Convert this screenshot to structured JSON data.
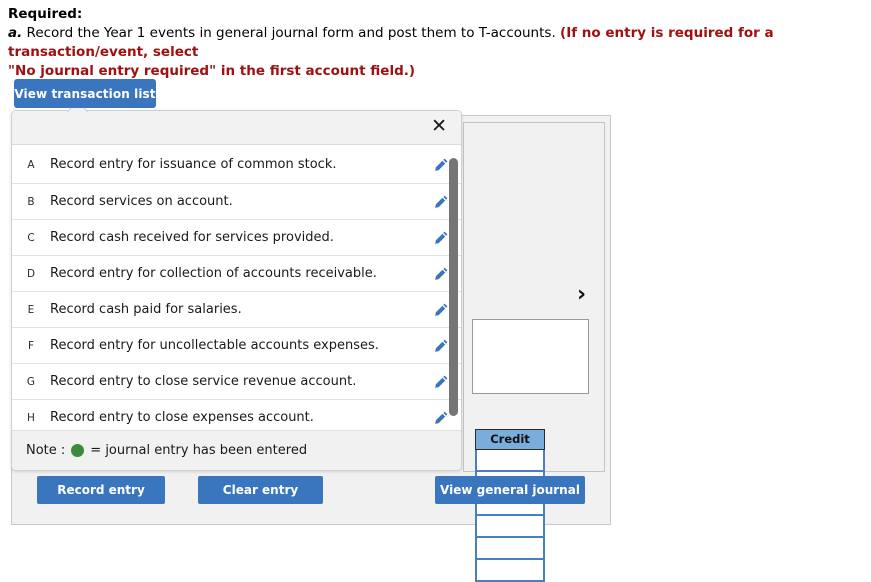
{
  "requirement": {
    "title": "Required:",
    "letter": "a.",
    "body": " Record the Year 1 events in general journal form and post them to T-accounts. ",
    "note_line1": "(If no entry is required for a transaction/event, select",
    "note_line2": "\"No journal entry required\" in the first account field.)",
    "note_color": "#a01010"
  },
  "toolbar": {
    "view_transaction_list_label": "View transaction list"
  },
  "modal": {
    "close_icon": "✕",
    "scrollbar": "vertical-scrollbar",
    "transactions": [
      {
        "letter": "A",
        "label": "Record entry for issuance of common stock.",
        "edit_icon": "pencil-icon"
      },
      {
        "letter": "B",
        "label": "Record services on account.",
        "edit_icon": "pencil-icon"
      },
      {
        "letter": "C",
        "label": "Record cash received for services provided.",
        "edit_icon": "pencil-icon"
      },
      {
        "letter": "D",
        "label": "Record entry for collection of accounts receivable.",
        "edit_icon": "pencil-icon"
      },
      {
        "letter": "E",
        "label": "Record cash paid for salaries.",
        "edit_icon": "pencil-icon"
      },
      {
        "letter": "F",
        "label": "Record entry for uncollectable accounts expenses.",
        "edit_icon": "pencil-icon"
      },
      {
        "letter": "G",
        "label": "Record entry to close service revenue account.",
        "edit_icon": "pencil-icon"
      },
      {
        "letter": "H",
        "label": "Record entry to close expenses account.",
        "edit_icon": "pencil-icon"
      }
    ],
    "note_prefix": "Note :",
    "note_suffix": "= journal entry has been entered",
    "note_dot_color": "#3c8a3c"
  },
  "worksheet": {
    "next_chevron_icon": "›",
    "credit_header": "Credit",
    "credit_cells": [
      "",
      "",
      "",
      "",
      "",
      ""
    ]
  },
  "footer": {
    "record_entry_label": "Record entry",
    "clear_entry_label": "Clear entry",
    "view_general_journal_label": "View general journal"
  },
  "colors": {
    "primary_button": "#3a76bd",
    "credit_header": "#7aacdc",
    "note_dot": "#3c8a3c",
    "warning_text": "#a01010"
  }
}
